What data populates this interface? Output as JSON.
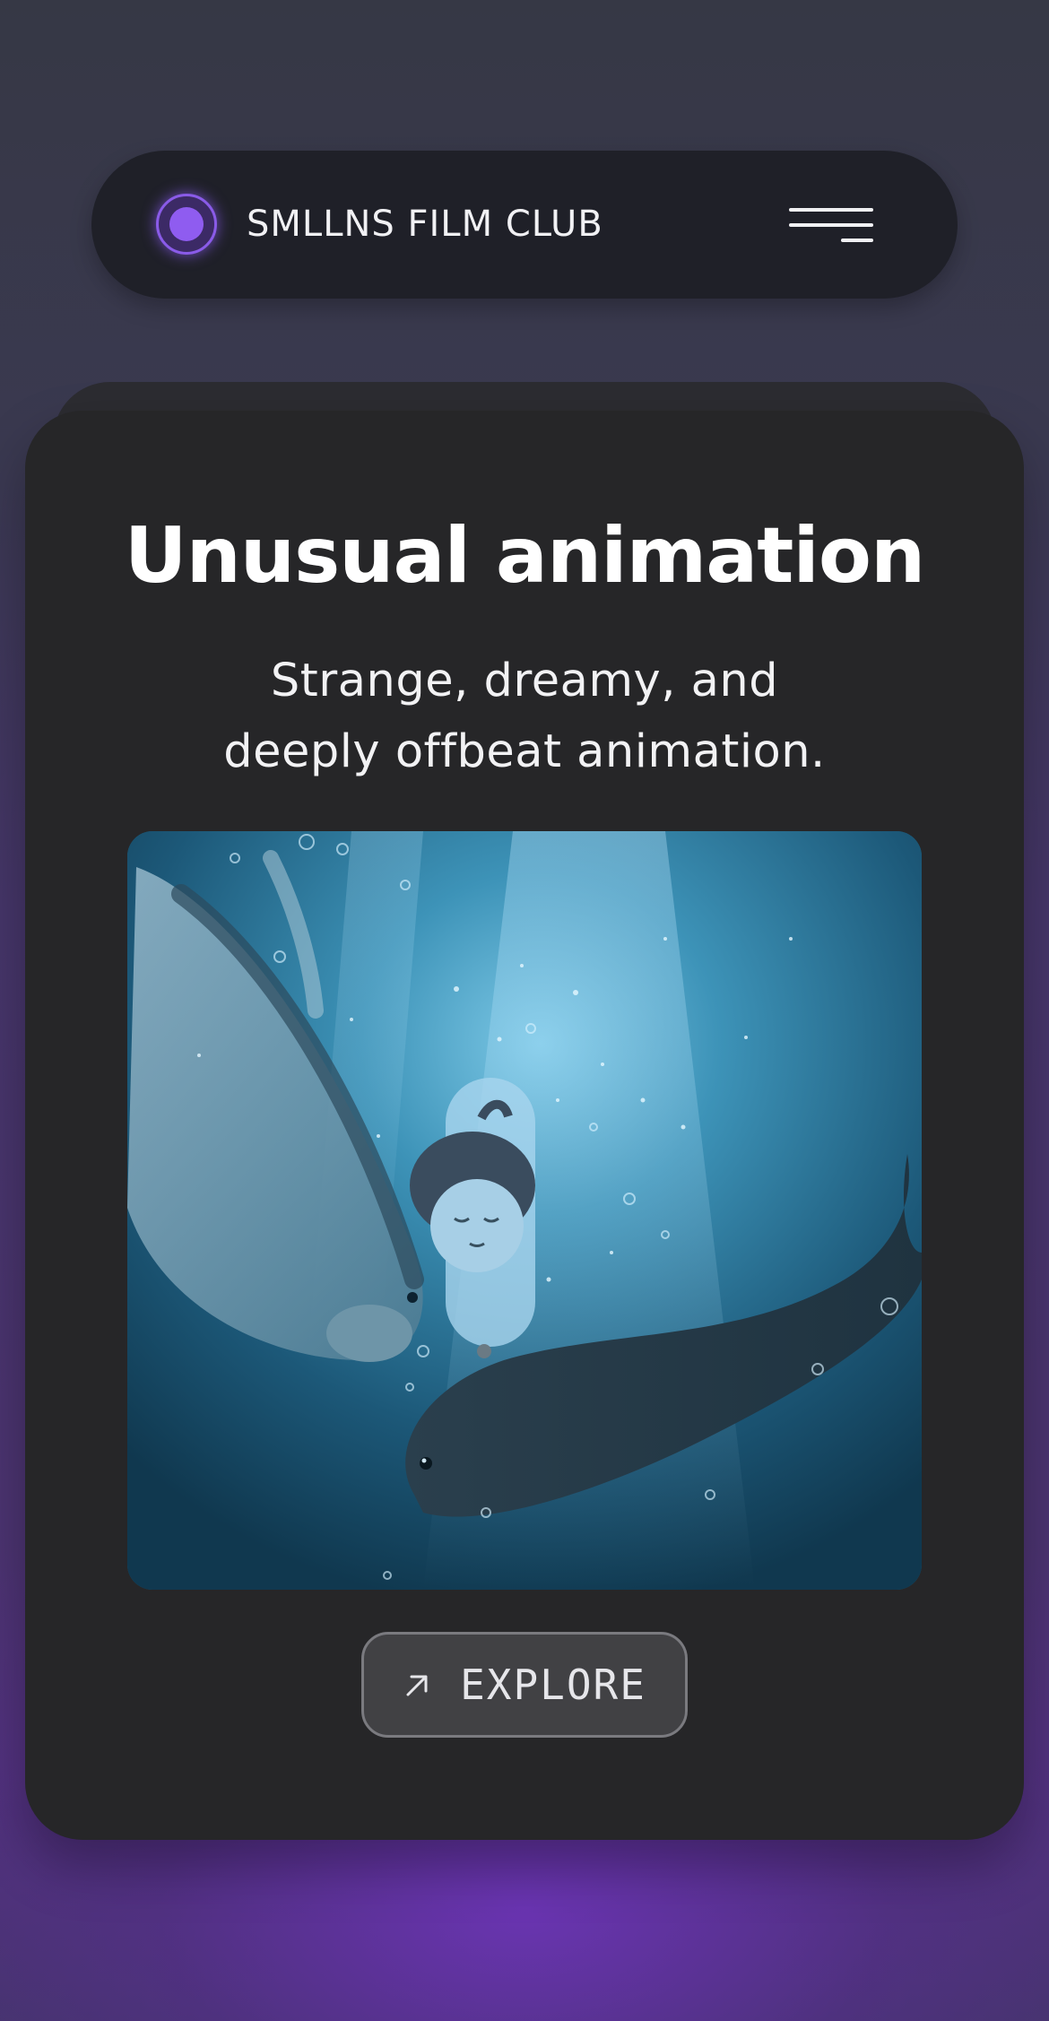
{
  "nav": {
    "brand": "SMLLNS FILM CLUB",
    "logo_icon": "glowing-purple-dot",
    "menu_icon": "hamburger-menu-icon"
  },
  "card": {
    "title": "Unusual animation",
    "subtitle": "Strange, dreamy, and deeply offbeat animation.",
    "image": {
      "subject": "animated-girl-with-seals-underwater",
      "dominant_colors": [
        "#1c5878",
        "#3d93b8",
        "#7cc8e6"
      ]
    },
    "explore_button": {
      "label": "EXPLORE",
      "icon": "arrow-up-right-icon"
    }
  },
  "colors": {
    "accent": "#8f5cf0",
    "nav_background": "#1f2028",
    "card_background": "#262628",
    "button_background": "#414144",
    "text_primary": "#ffffff"
  }
}
